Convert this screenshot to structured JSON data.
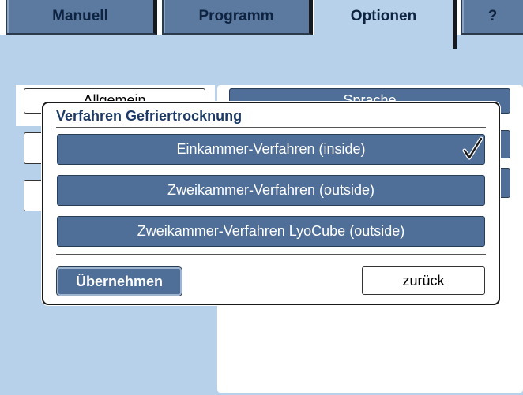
{
  "tabs": [
    {
      "label": "Manuell"
    },
    {
      "label": "Programm"
    },
    {
      "label": "Optionen"
    },
    {
      "label": "?"
    }
  ],
  "background": {
    "left_button_label": "Allgemein",
    "right_button_label": "Sprache"
  },
  "dialog": {
    "title": "Verfahren Gefriertrocknung",
    "options": [
      {
        "label": "Einkammer-Verfahren (inside)",
        "selected": true
      },
      {
        "label": "Zweikammer-Verfahren (outside)",
        "selected": false
      },
      {
        "label": "Zweikammer-Verfahren LyoCube (outside)",
        "selected": false
      }
    ],
    "apply_label": "Übernehmen",
    "back_label": "zurück"
  },
  "colors": {
    "tab_blue": "#5c7aa0",
    "button_blue": "#4f6f99",
    "page_background": "#b7d1ea",
    "title_text": "#1d3a66"
  },
  "icons": {
    "selected_marker": "check-icon"
  }
}
